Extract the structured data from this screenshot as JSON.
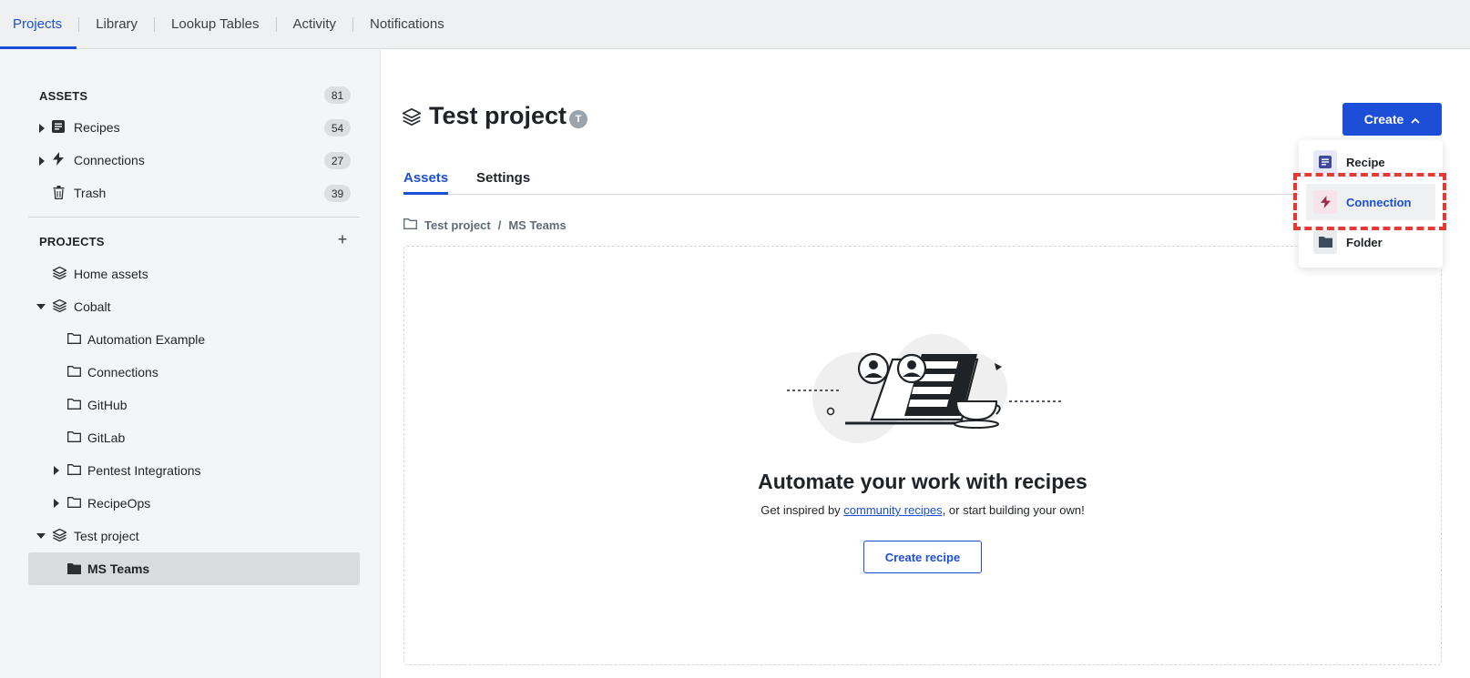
{
  "topnav": {
    "tabs": [
      "Projects",
      "Library",
      "Lookup Tables",
      "Activity",
      "Notifications"
    ]
  },
  "sidebar": {
    "assets_heading": "ASSETS",
    "assets_count": "81",
    "assets": [
      {
        "label": "Recipes",
        "count": "54"
      },
      {
        "label": "Connections",
        "count": "27"
      },
      {
        "label": "Trash",
        "count": "39"
      }
    ],
    "projects_heading": "PROJECTS",
    "projects": [
      {
        "label": "Home assets"
      },
      {
        "label": "Cobalt"
      },
      {
        "label": "Automation Example"
      },
      {
        "label": "Connections"
      },
      {
        "label": "GitHub"
      },
      {
        "label": "GitLab"
      },
      {
        "label": "Pentest Integrations"
      },
      {
        "label": "RecipeOps"
      },
      {
        "label": "Test project"
      },
      {
        "label": "MS Teams"
      }
    ]
  },
  "main": {
    "title": "Test project",
    "title_badge": "T",
    "create_label": "Create",
    "tabs": [
      "Assets",
      "Settings"
    ],
    "breadcrumb": {
      "project": "Test project",
      "folder": "MS Teams"
    },
    "empty_title": "Automate your work with recipes",
    "empty_sub_prefix": "Get inspired by ",
    "empty_sub_link": "community recipes",
    "empty_sub_suffix": ", or start building your own!",
    "create_recipe_label": "Create recipe"
  },
  "create_menu": {
    "items": [
      {
        "label": "Recipe",
        "icon": "recipe-icon"
      },
      {
        "label": "Connection",
        "icon": "lightning-icon",
        "highlighted": true
      },
      {
        "label": "Folder",
        "icon": "folder-icon"
      }
    ]
  },
  "colors": {
    "accent": "#1d4ed8",
    "highlight_box": "#e53935"
  }
}
